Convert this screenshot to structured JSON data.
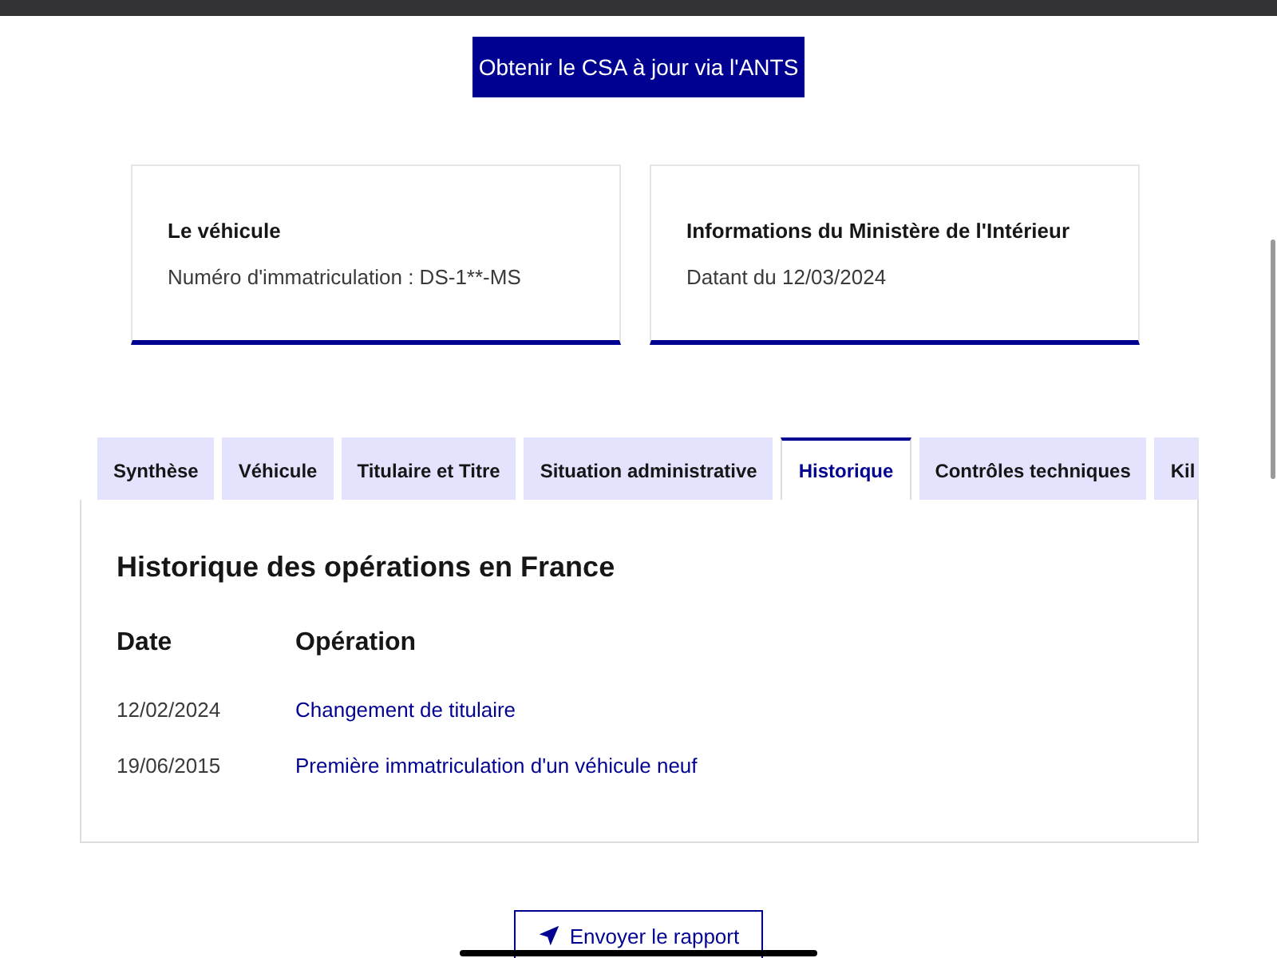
{
  "top_button": "Obtenir le CSA à jour via l'ANTS",
  "cards": [
    {
      "title": "Le véhicule",
      "text": "Numéro d'immatriculation : DS-1**-MS"
    },
    {
      "title": "Informations du Ministère de l'Intérieur",
      "text": "Datant du 12/03/2024"
    }
  ],
  "tabs": [
    {
      "label": "Synthèse",
      "selected": false
    },
    {
      "label": "Véhicule",
      "selected": false
    },
    {
      "label": "Titulaire et Titre",
      "selected": false
    },
    {
      "label": "Situation administrative",
      "selected": false
    },
    {
      "label": "Historique",
      "selected": true
    },
    {
      "label": "Contrôles techniques",
      "selected": false
    },
    {
      "label": "Kil",
      "selected": false
    }
  ],
  "panel": {
    "title": "Historique des opérations en France",
    "columns": [
      "Date",
      "Opération"
    ],
    "rows": [
      {
        "date": "12/02/2024",
        "operation": "Changement de titulaire"
      },
      {
        "date": "19/06/2015",
        "operation": "Première immatriculation d'un véhicule neuf"
      }
    ]
  },
  "send_button": "Envoyer le rapport"
}
